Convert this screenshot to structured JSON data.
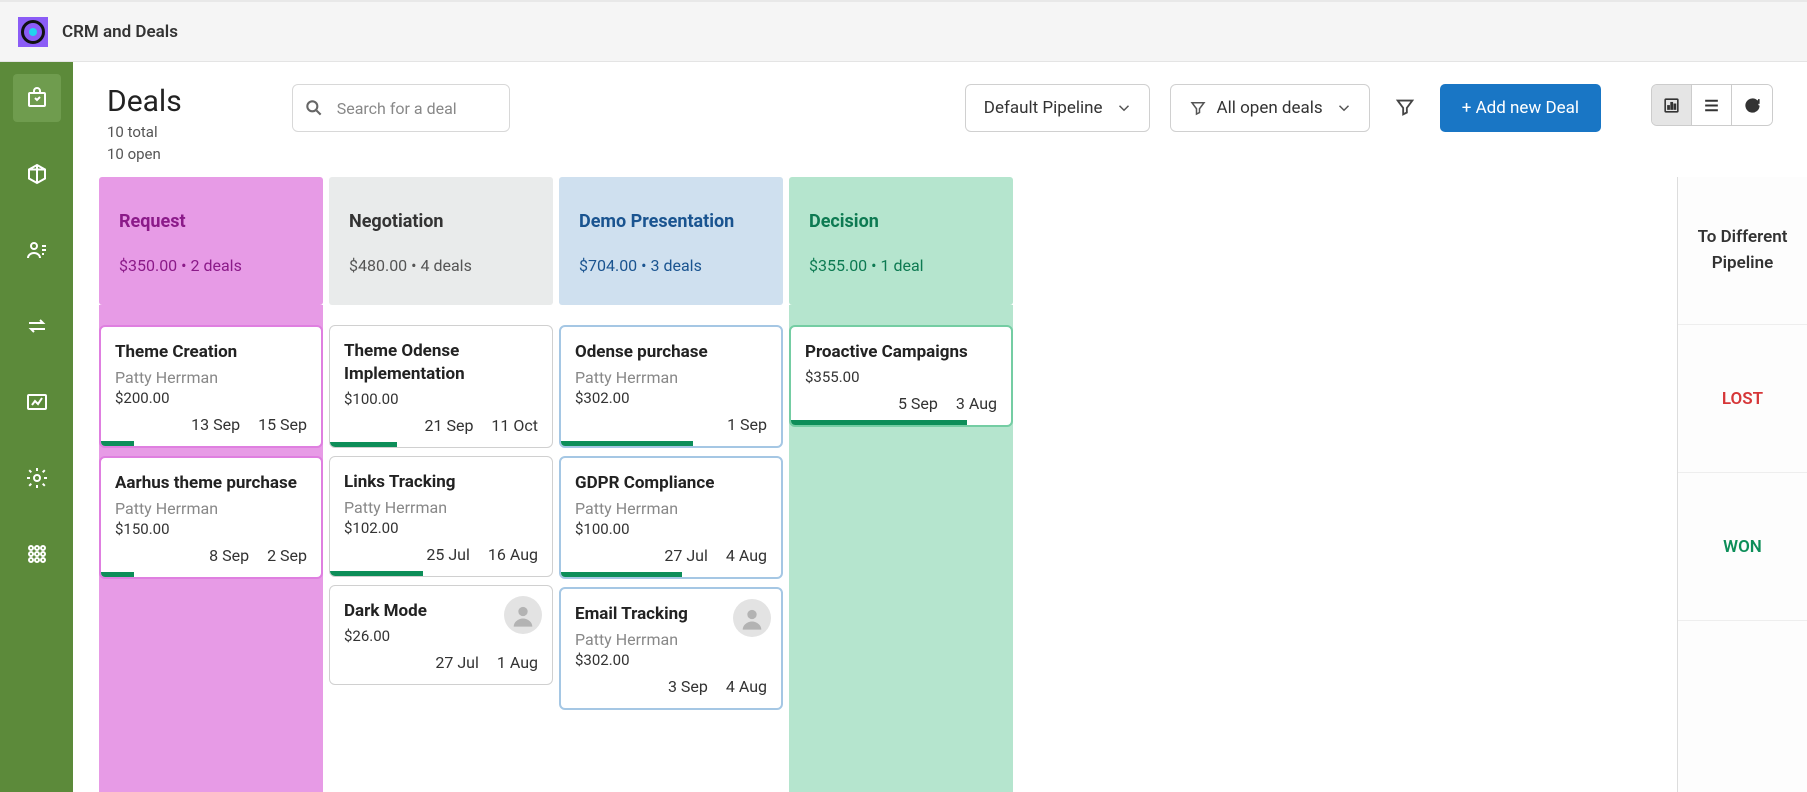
{
  "app_title": "CRM and Deals",
  "page": {
    "title": "Deals",
    "total": "10 total",
    "open": "10 open"
  },
  "search": {
    "placeholder": "Search for a deal"
  },
  "pipeline_select": {
    "label": "Default Pipeline"
  },
  "filter_select": {
    "label": "All open deals"
  },
  "add_button": "+ Add new Deal",
  "side_panel": {
    "pipe": "To Different Pipeline",
    "lost": "LOST",
    "won": "WON"
  },
  "columns": [
    {
      "title": "Request",
      "amount": "$350.00",
      "count": "2 deals",
      "cards": [
        {
          "title": "Theme Creation",
          "contact": "Patty Herrman",
          "amount": "$200.00",
          "d1": "13 Sep",
          "d2": "15 Sep",
          "bar": 15
        },
        {
          "title": "Aarhus theme purchase",
          "contact": "Patty Herrman",
          "amount": "$150.00",
          "d1": "8 Sep",
          "d2": "2 Sep",
          "bar": 15
        }
      ]
    },
    {
      "title": "Negotiation",
      "amount": "$480.00",
      "count": "4 deals",
      "cards": [
        {
          "title": "Theme Odense Implementation",
          "contact": "",
          "amount": "$100.00",
          "d1": "21 Sep",
          "d2": "11 Oct",
          "bar": 30
        },
        {
          "title": "Links Tracking",
          "contact": "Patty Herrman",
          "amount": "$102.00",
          "d1": "25 Jul",
          "d2": "16 Aug",
          "bar": 42
        },
        {
          "title": "Dark Mode",
          "contact": "",
          "amount": "$26.00",
          "d1": "27 Jul",
          "d2": "1 Aug",
          "bar": 0,
          "avatar": true
        }
      ]
    },
    {
      "title": "Demo Presentation",
      "amount": "$704.00",
      "count": "3 deals",
      "cards": [
        {
          "title": "Odense purchase",
          "contact": "Patty Herrman",
          "amount": "$302.00",
          "d1": "",
          "d2": "1 Sep",
          "bar": 60
        },
        {
          "title": "GDPR Compliance",
          "contact": "Patty Herrman",
          "amount": "$100.00",
          "d1": "27 Jul",
          "d2": "4 Aug",
          "bar": 55
        },
        {
          "title": "Email Tracking",
          "contact": "Patty Herrman",
          "amount": "$302.00",
          "d1": "3 Sep",
          "d2": "4 Aug",
          "bar": 0,
          "avatar": true
        }
      ]
    },
    {
      "title": "Decision",
      "amount": "$355.00",
      "count": "1 deal",
      "cards": [
        {
          "title": "Proactive Campaigns",
          "contact": "",
          "amount": "$355.00",
          "d1": "5 Sep",
          "d2": "3 Aug",
          "bar": 80
        }
      ]
    }
  ]
}
